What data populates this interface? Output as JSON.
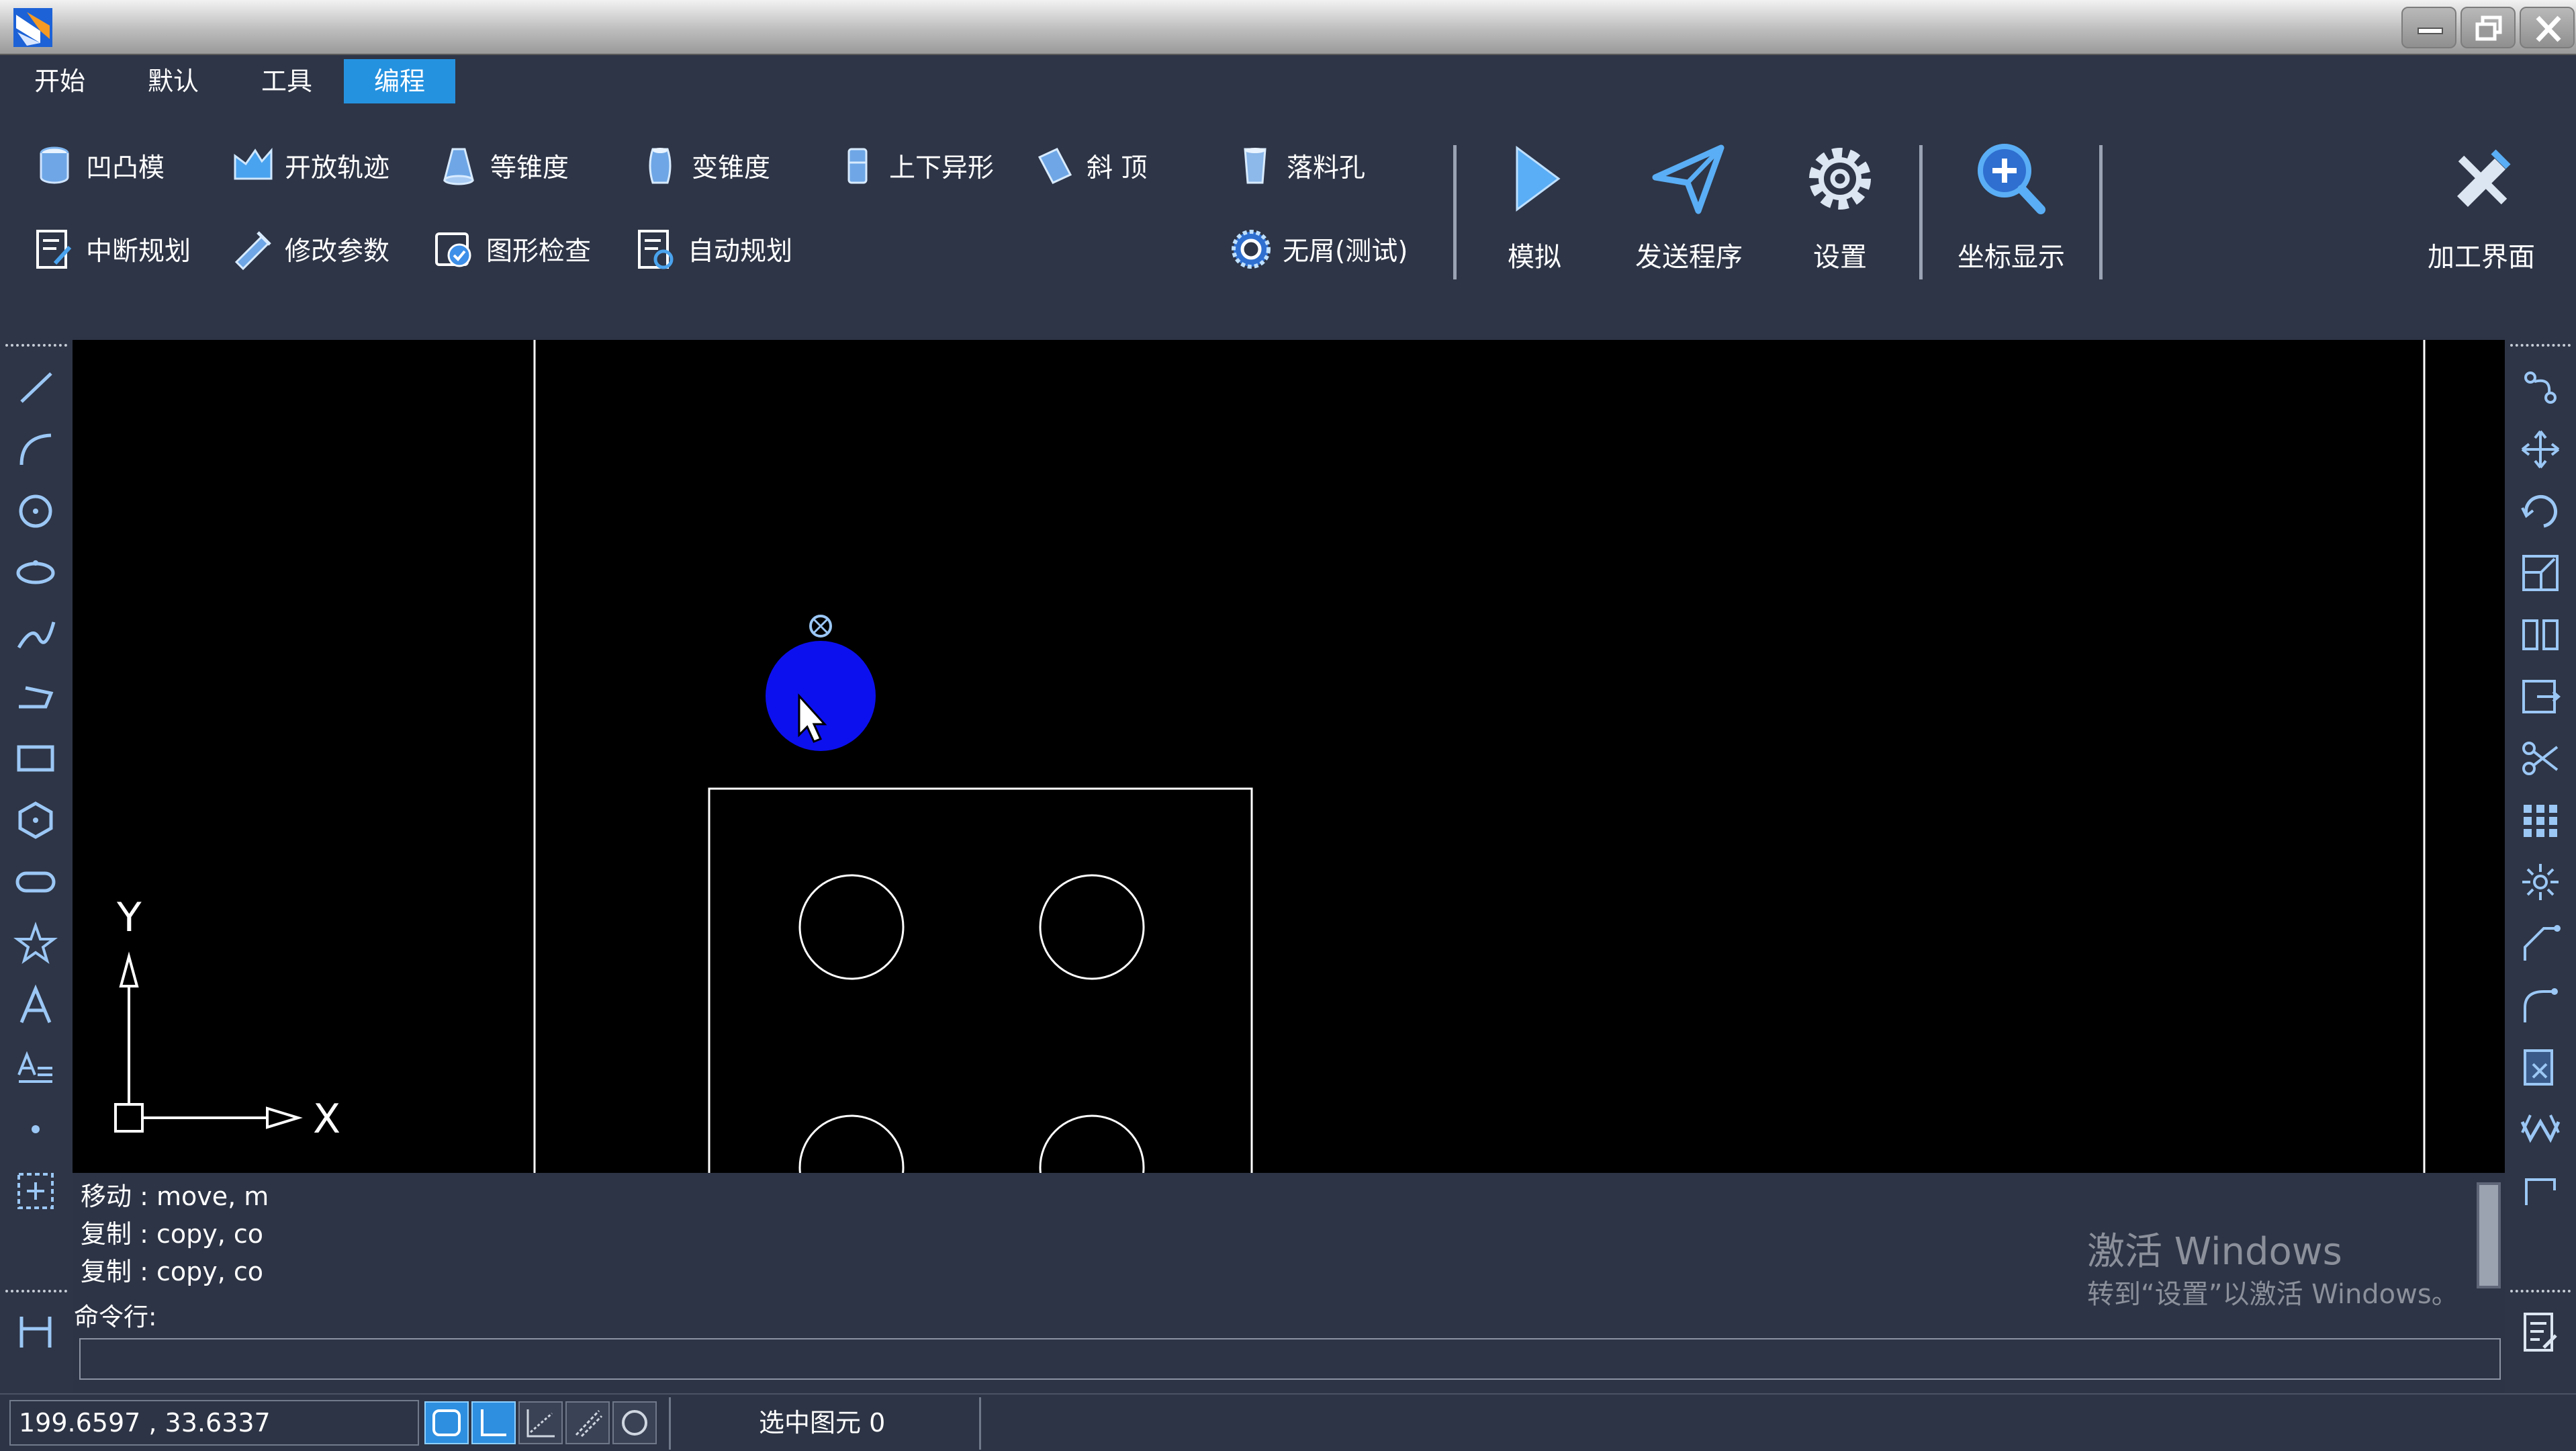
{
  "window": {
    "logo_icon": "app-logo-icon",
    "controls": [
      "minimize-icon",
      "restore-icon",
      "close-icon"
    ]
  },
  "menu": {
    "tabs": [
      {
        "label": "开始",
        "active": false
      },
      {
        "label": "默认",
        "active": false
      },
      {
        "label": "工具",
        "active": false
      },
      {
        "label": "编程",
        "active": true
      }
    ]
  },
  "ribbon": {
    "row1": [
      {
        "label": "凹凸模",
        "icon": "cylinder-icon"
      },
      {
        "label": "开放轨迹",
        "icon": "open-path-icon"
      },
      {
        "label": "等锥度",
        "icon": "cone-icon"
      },
      {
        "label": "变锥度",
        "icon": "variable-taper-icon"
      },
      {
        "label": "上下异形",
        "icon": "upper-lower-shape-icon"
      },
      {
        "label": "斜 顶",
        "icon": "slant-top-icon"
      },
      {
        "label": "落料孔",
        "icon": "drop-hole-icon"
      }
    ],
    "row2": [
      {
        "label": "中断规划",
        "icon": "interrupt-plan-icon"
      },
      {
        "label": "修改参数",
        "icon": "modify-params-icon"
      },
      {
        "label": "图形检查",
        "icon": "graphic-check-icon"
      },
      {
        "label": "自动规划",
        "icon": "auto-plan-icon"
      },
      {
        "label": "无屑(测试)",
        "icon": "no-chip-icon"
      }
    ],
    "big_buttons": [
      {
        "label": "模拟",
        "icon": "play-icon"
      },
      {
        "label": "发送程序",
        "icon": "send-icon"
      },
      {
        "label": "设置",
        "icon": "gear-icon"
      },
      {
        "label": "坐标显示",
        "icon": "zoom-icon"
      },
      {
        "label": "加工界面",
        "icon": "machining-icon"
      }
    ]
  },
  "left_tools": [
    "line-icon",
    "arc-icon",
    "circle-icon",
    "ellipse-icon",
    "spline-icon",
    "polyline-icon",
    "rectangle-icon",
    "polygon-icon",
    "slot-icon",
    "star-icon",
    "letter-a-icon",
    "text-icon",
    "point-icon",
    "select-box-icon",
    "dimension-icon"
  ],
  "right_tools": [
    "trim-node-icon",
    "move-icon",
    "rotate-icon",
    "scale-icon",
    "mirror-icon",
    "offset-icon",
    "scissors-icon",
    "array-icon",
    "explode-icon",
    "chamfer-icon",
    "fillet-icon",
    "extend-icon",
    "break-icon",
    "corner-icon",
    "properties-icon"
  ],
  "canvas": {
    "axis_y_label": "Y",
    "axis_x_label": "X"
  },
  "command": {
    "history": [
      "移动 : move, m",
      "复制 : copy, co",
      "复制 : copy, co"
    ],
    "label": "命令行:",
    "input_value": ""
  },
  "watermark": {
    "title": "激活 Windows",
    "subtitle": "转到“设置”以激活 Windows。"
  },
  "status": {
    "coordinates": "199.6597 , 33.6337",
    "snap_buttons": [
      {
        "icon": "snap-endpoint-icon",
        "on": true
      },
      {
        "icon": "snap-ortho-icon",
        "on": true
      },
      {
        "icon": "snap-grid-icon",
        "on": false
      },
      {
        "icon": "snap-tangent-icon",
        "on": false
      },
      {
        "icon": "snap-circle-icon",
        "on": false
      }
    ],
    "selected_label": "选中图元",
    "selected_count": "0"
  },
  "colors": {
    "accent": "#2592e0",
    "panel": "#2e3546",
    "canvas": "#000000",
    "marker": "#0c10ee"
  }
}
